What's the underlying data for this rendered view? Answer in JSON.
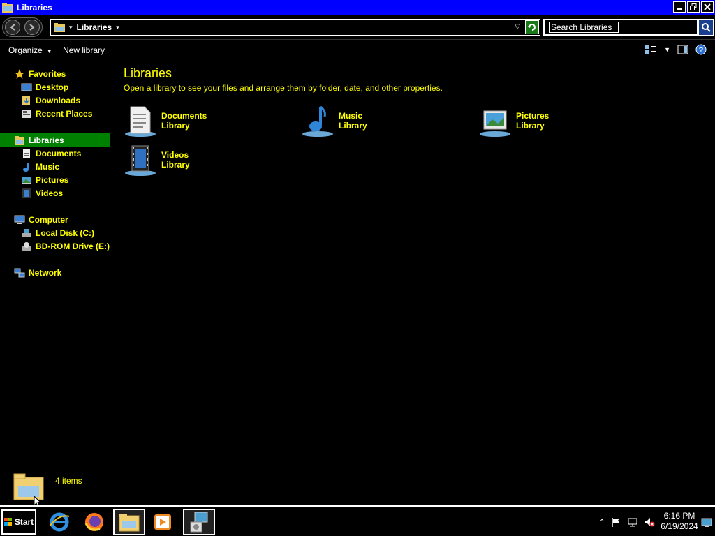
{
  "window": {
    "title": "Libraries"
  },
  "address": {
    "crumb": "Libraries"
  },
  "search": {
    "placeholder": "Search Libraries"
  },
  "toolbar": {
    "organize_label": "Organize",
    "new_library_label": "New library"
  },
  "nav": {
    "favorites": {
      "label": "Favorites",
      "items": [
        {
          "label": "Desktop"
        },
        {
          "label": "Downloads"
        },
        {
          "label": "Recent Places"
        }
      ]
    },
    "libraries": {
      "label": "Libraries",
      "items": [
        {
          "label": "Documents"
        },
        {
          "label": "Music"
        },
        {
          "label": "Pictures"
        },
        {
          "label": "Videos"
        }
      ]
    },
    "computer": {
      "label": "Computer",
      "items": [
        {
          "label": "Local Disk (C:)"
        },
        {
          "label": "BD-ROM Drive (E:)"
        }
      ]
    },
    "network": {
      "label": "Network"
    }
  },
  "content": {
    "title": "Libraries",
    "subtitle": "Open a library to see your files and arrange them by folder, date, and other properties.",
    "libraries": [
      {
        "name": "Documents",
        "type": "Library",
        "icon": "documents-library-icon"
      },
      {
        "name": "Music",
        "type": "Library",
        "icon": "music-library-icon"
      },
      {
        "name": "Pictures",
        "type": "Library",
        "icon": "pictures-library-icon"
      },
      {
        "name": "Videos",
        "type": "Library",
        "icon": "videos-library-icon"
      }
    ]
  },
  "details": {
    "count": "4 items"
  },
  "taskbar": {
    "start_label": "Start",
    "apps": [
      "internet-explorer-icon",
      "firefox-icon",
      "windows-explorer-icon",
      "media-player-icon",
      "installer-icon"
    ]
  },
  "clock": {
    "time": "6:16 PM",
    "date": "6/19/2024"
  },
  "colors": {
    "titlebar": "#0000ff",
    "text_highlight": "#ffff00",
    "selection": "#008000",
    "background": "#000000"
  }
}
